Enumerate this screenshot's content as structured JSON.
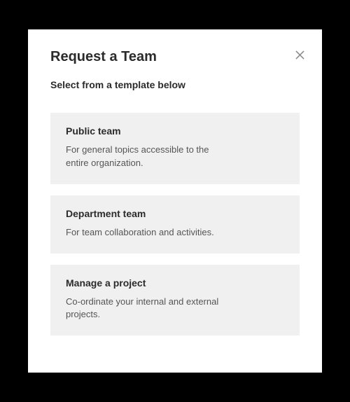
{
  "dialog": {
    "title": "Request a Team",
    "subtitle": "Select from a template below"
  },
  "templates": [
    {
      "title": "Public team",
      "description": "For general topics accessible to the entire organization."
    },
    {
      "title": "Department team",
      "description": "For team collaboration and activities."
    },
    {
      "title": "Manage a project",
      "description": "Co-ordinate your internal and external projects."
    }
  ]
}
